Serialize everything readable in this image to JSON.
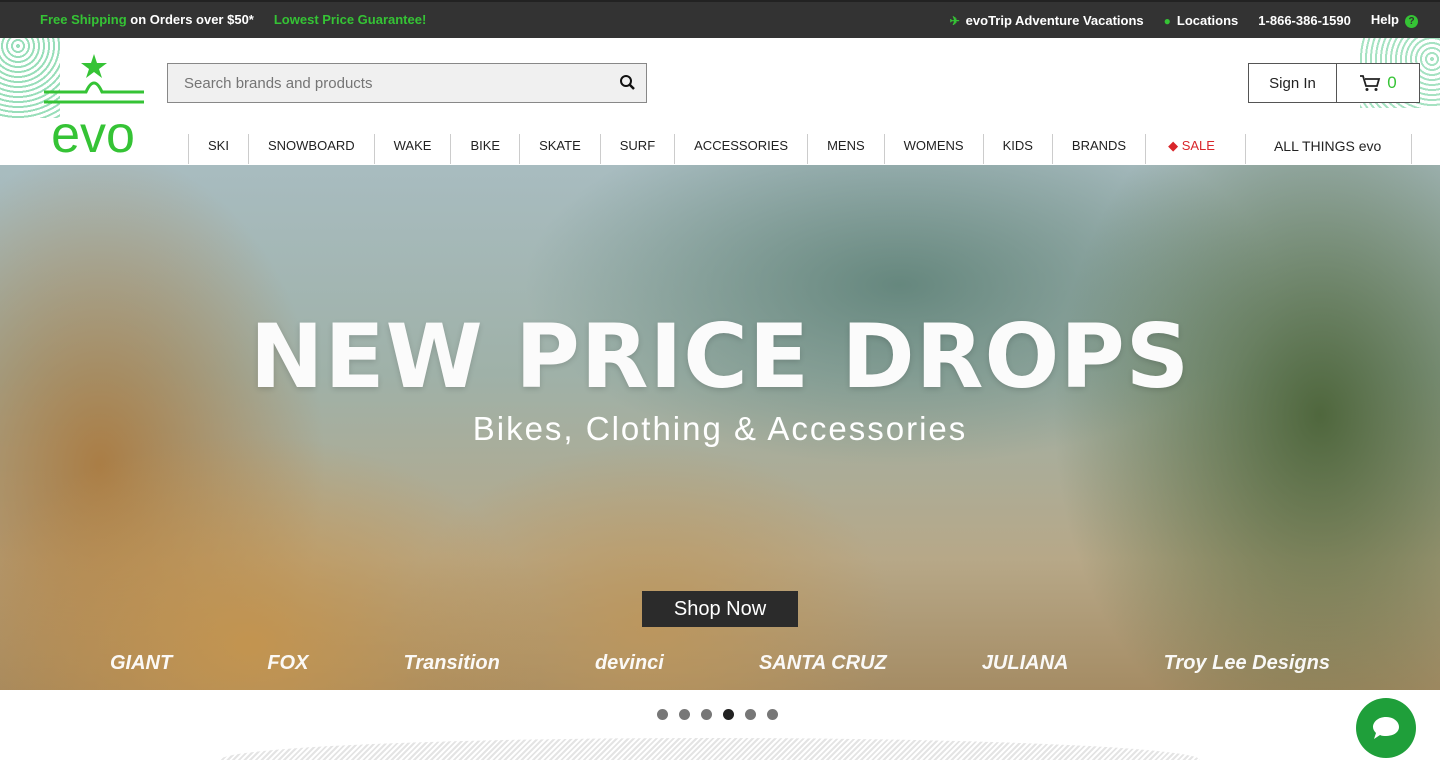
{
  "topbar": {
    "free_shipping": "Free Shipping",
    "orders_over": "on Orders over $50*",
    "lowest_price": "Lowest Price Guarantee!",
    "evotrip": "evoTrip Adventure Vacations",
    "locations": "Locations",
    "phone": "1-866-386-1590",
    "help": "Help"
  },
  "logo": {
    "text": "evo"
  },
  "search": {
    "placeholder": "Search brands and products"
  },
  "account": {
    "signin": "Sign In",
    "cart_count": "0"
  },
  "nav": {
    "items": [
      "SKI",
      "SNOWBOARD",
      "WAKE",
      "BIKE",
      "SKATE",
      "SURF",
      "ACCESSORIES",
      "MENS",
      "WOMENS",
      "KIDS",
      "BRANDS"
    ],
    "sale": "SALE",
    "all_things": "ALL THINGS evo"
  },
  "hero": {
    "title": "NEW PRICE DROPS",
    "subtitle": "Bikes, Clothing & Accessories",
    "cta": "Shop Now",
    "brands": [
      "GIANT",
      "FOX",
      "Transition",
      "devinci",
      "SANTA CRUZ",
      "JULIANA",
      "Troy Lee Designs"
    ]
  },
  "carousel": {
    "total": 6,
    "active": 4
  },
  "colors": {
    "brand_green": "#35c335",
    "sale_red": "#d9262b",
    "topbar": "#333333",
    "chat": "#1f9f3a"
  }
}
